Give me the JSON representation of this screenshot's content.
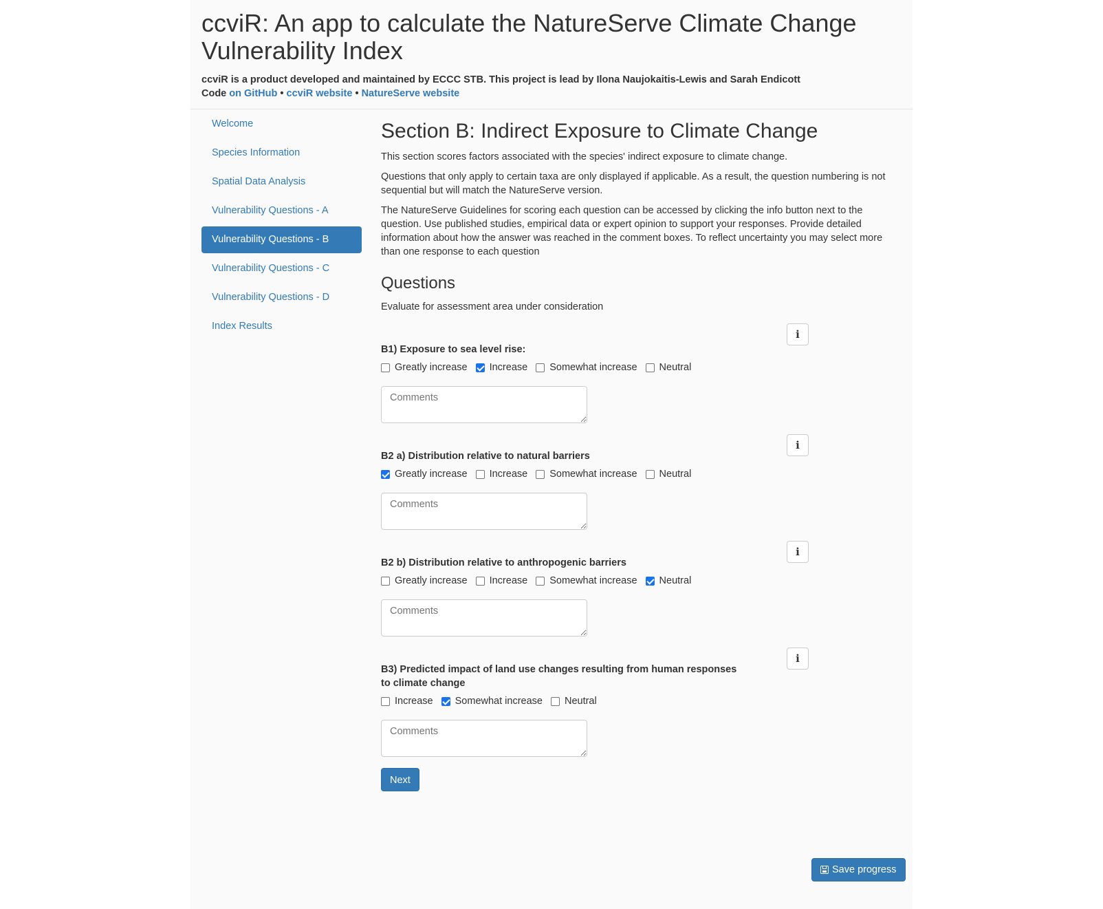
{
  "header": {
    "title": "ccviR: An app to calculate the NatureServe Climate Change Vulnerability Index",
    "credit": "ccviR is a product developed and maintained by ECCC STB. This project is lead by Ilona Naujokaitis-Lewis and Sarah Endicott",
    "code_prefix": "Code",
    "github_link": "on GitHub",
    "sep": "•",
    "website_link": "ccviR website",
    "natureserve_link": "NatureServe website"
  },
  "sidebar": {
    "items": [
      {
        "label": "Welcome"
      },
      {
        "label": "Species Information"
      },
      {
        "label": "Spatial Data Analysis"
      },
      {
        "label": "Vulnerability Questions - A"
      },
      {
        "label": "Vulnerability Questions - B"
      },
      {
        "label": "Vulnerability Questions - C"
      },
      {
        "label": "Vulnerability Questions - D"
      },
      {
        "label": "Index Results"
      }
    ],
    "active_index": 4
  },
  "main": {
    "title": "Section B: Indirect Exposure to Climate Change",
    "intro1": "This section scores factors associated with the species' indirect exposure to climate change.",
    "intro2": "Questions that only apply to certain taxa are only displayed if applicable. As a result, the question numbering is not sequential but will match the NatureServe version.",
    "intro3": "The NatureServe Guidelines for scoring each question can be accessed by clicking the info button next to the question. Use published studies, empirical data or expert opinion to support your responses. Provide detailed information about how the answer was reached in the comment boxes. To reflect uncertainty you may select more than one response to each question",
    "questions_heading": "Questions",
    "questions_sub": "Evaluate for assessment area under consideration",
    "info_glyph": "i",
    "comment_placeholder": "Comments",
    "questions": [
      {
        "label": "B1) Exposure to sea level rise:",
        "options": [
          {
            "label": "Greatly increase",
            "checked": false
          },
          {
            "label": "Increase",
            "checked": true
          },
          {
            "label": "Somewhat increase",
            "checked": false
          },
          {
            "label": "Neutral",
            "checked": false
          }
        ]
      },
      {
        "label": "B2 a) Distribution relative to natural barriers",
        "options": [
          {
            "label": "Greatly increase",
            "checked": true
          },
          {
            "label": "Increase",
            "checked": false
          },
          {
            "label": "Somewhat increase",
            "checked": false
          },
          {
            "label": "Neutral",
            "checked": false
          }
        ]
      },
      {
        "label": "B2 b) Distribution relative to anthropogenic barriers",
        "options": [
          {
            "label": "Greatly increase",
            "checked": false
          },
          {
            "label": "Increase",
            "checked": false
          },
          {
            "label": "Somewhat increase",
            "checked": false
          },
          {
            "label": "Neutral",
            "checked": true
          }
        ]
      },
      {
        "label": "B3) Predicted impact of land use changes resulting from human responses to climate change",
        "options": [
          {
            "label": "Increase",
            "checked": false
          },
          {
            "label": "Somewhat increase",
            "checked": true
          },
          {
            "label": "Neutral",
            "checked": false
          }
        ]
      }
    ],
    "next_label": "Next"
  },
  "save_label": "Save progress",
  "colors": {
    "accent": "#337ab7",
    "checkbox": "#1a73e8"
  }
}
